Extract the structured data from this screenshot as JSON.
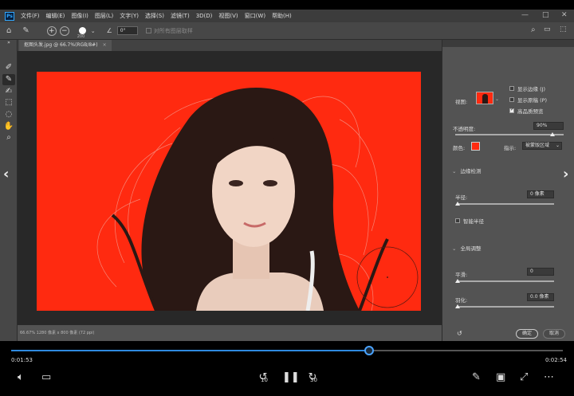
{
  "menubar": {
    "logo": "Ps",
    "items": [
      "文件(F)",
      "编辑(E)",
      "图像(I)",
      "图层(L)",
      "文字(Y)",
      "选择(S)",
      "滤镜(T)",
      "3D(D)",
      "视图(V)",
      "窗口(W)",
      "帮助(H)"
    ]
  },
  "options": {
    "brush_size": "200",
    "angle": "0°",
    "sample_all_layers": "对所有图层取样"
  },
  "document": {
    "tab_title": "抠图头发.jpg @ 66.7%(RGB/8#)",
    "status": "66.67%    1280 像素 x 800 像素 (72 ppi)"
  },
  "properties": {
    "view_label": "视图:",
    "show_edge": "显示边缘 (J)",
    "show_original": "显示原稿 (P)",
    "hq_preview": "高品质预览",
    "opacity_label": "不透明度:",
    "opacity_value": "90%",
    "opacity_fraction": 0.9,
    "color_label": "颜色:",
    "overlay_color": "#ff2a10",
    "op_label": "指示:",
    "op_value": "被蒙版区域",
    "edge_detect_section": "边缘检测",
    "radius_label": "半径:",
    "radius_value": "0 像素",
    "smart_radius": "智能半径",
    "global_section": "全局调整",
    "smooth_label": "平滑:",
    "smooth_value": "0",
    "feather_label": "羽化:",
    "feather_value": "0.0 像素",
    "ok": "确定",
    "cancel": "取消"
  },
  "player": {
    "current_time": "0:01:53",
    "total_time": "0:02:54",
    "progress": 0.6494,
    "skip_back": "10",
    "skip_forward": "30",
    "accent": "#2f8ae0"
  }
}
